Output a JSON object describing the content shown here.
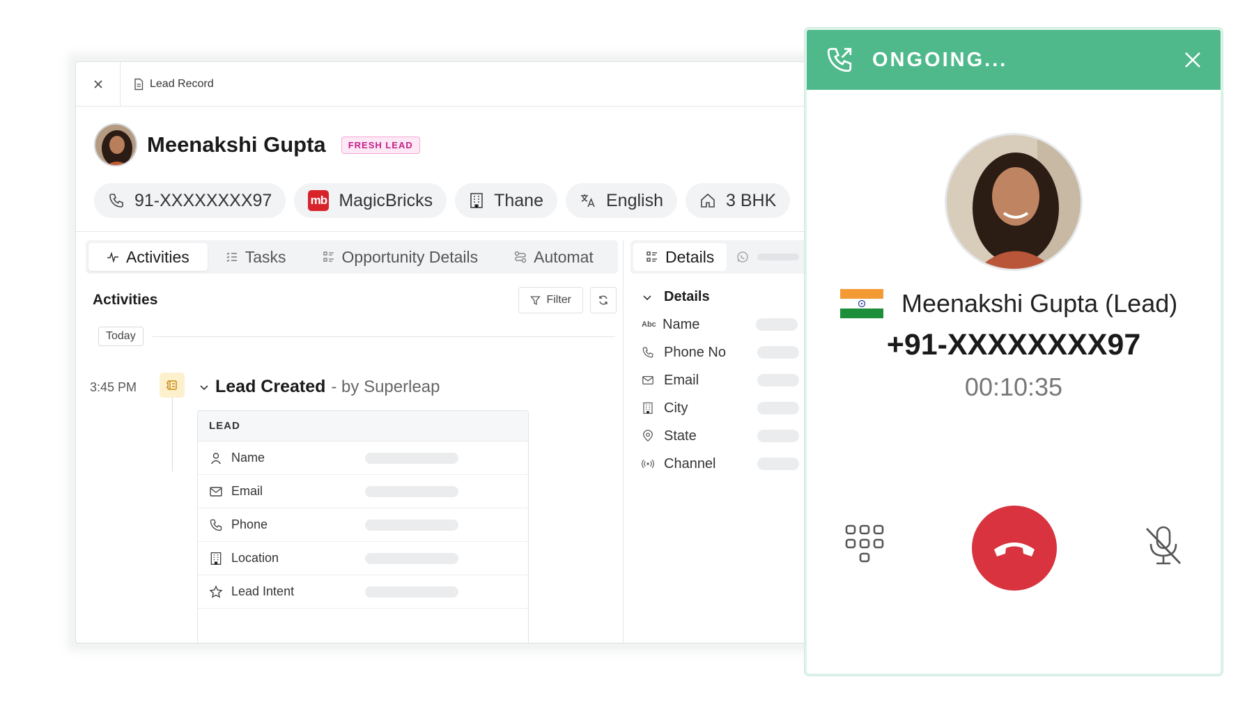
{
  "record": {
    "header_title": "Lead Record",
    "lead_name": "Meenakshi Gupta",
    "badge": "FRESH LEAD",
    "chips": [
      {
        "icon": "phone-icon",
        "label": "91-XXXXXXXX97"
      },
      {
        "icon": "magicbricks-logo",
        "logo_text": "mb",
        "label": "MagicBricks"
      },
      {
        "icon": "building-icon",
        "label": "Thane"
      },
      {
        "icon": "translate-icon",
        "label": "English"
      },
      {
        "icon": "home-icon",
        "label": "3 BHK"
      }
    ]
  },
  "tabs": [
    {
      "label": "Activities",
      "active": true
    },
    {
      "label": "Tasks"
    },
    {
      "label": "Opportunity Details"
    },
    {
      "label": "Automat"
    }
  ],
  "activities": {
    "title": "Activities",
    "filter_label": "Filter",
    "today_label": "Today",
    "event_time": "3:45 PM",
    "event_title": "Lead Created",
    "event_by": "- by Superleap",
    "box_header": "LEAD",
    "rows": [
      "Name",
      "Email",
      "Phone",
      "Location",
      "Lead Intent"
    ]
  },
  "details": {
    "tab_label": "Details",
    "section_title": "Details",
    "rows": [
      "Name",
      "Phone No",
      "Email",
      "City",
      "State",
      "Channel"
    ]
  },
  "call": {
    "status": "ONGOING...",
    "caller_name": "Meenakshi Gupta (Lead)",
    "phone": "+91-XXXXXXXX97",
    "duration": "00:10:35",
    "colors": {
      "header": "#4fb98c",
      "hangup": "#d8333e"
    }
  }
}
